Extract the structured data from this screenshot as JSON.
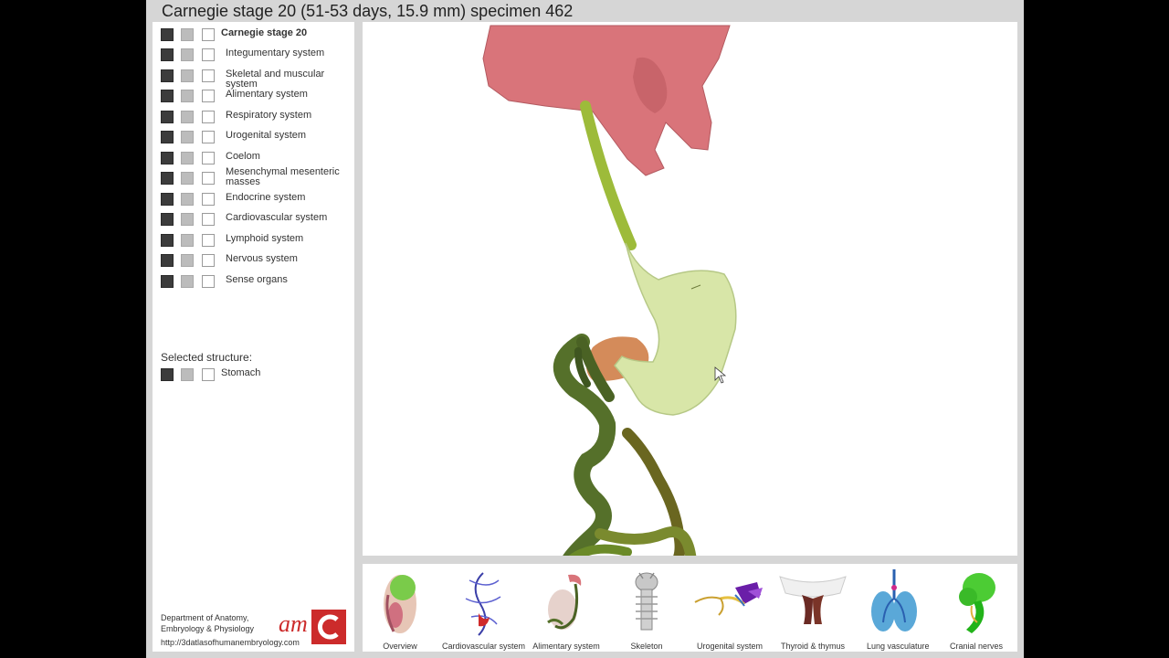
{
  "header": {
    "title": "Carnegie stage 20 (51-53 days, 15.9 mm) specimen 462"
  },
  "systems": [
    {
      "label": "Carnegie stage 20",
      "bold": true
    },
    {
      "label": "Integumentary system"
    },
    {
      "label": "Skeletal and muscular system"
    },
    {
      "label": "Alimentary system"
    },
    {
      "label": "Respiratory system"
    },
    {
      "label": "Urogenital system"
    },
    {
      "label": "Coelom"
    },
    {
      "label": "Mesenchymal mesenteric masses"
    },
    {
      "label": "Endocrine system"
    },
    {
      "label": "Cardiovascular system"
    },
    {
      "label": "Lymphoid system"
    },
    {
      "label": "Nervous system"
    },
    {
      "label": "Sense organs"
    }
  ],
  "selected": {
    "heading": "Selected structure:",
    "label": "Stomach"
  },
  "footer": {
    "dept_line1": "Department of Anatomy,",
    "dept_line2": "Embryology & Physiology",
    "url": "http://3datlasofhumanembryology.com",
    "logo_text": "am"
  },
  "thumbnails": [
    {
      "label": "Overview",
      "icon": "overview-thumbnail"
    },
    {
      "label": "Cardiovascular system",
      "icon": "cardiovascular-thumbnail"
    },
    {
      "label": "Alimentary system",
      "icon": "alimentary-thumbnail"
    },
    {
      "label": "Skeleton",
      "icon": "skeleton-thumbnail"
    },
    {
      "label": "Urogenital system",
      "icon": "urogenital-thumbnail"
    },
    {
      "label": "Thyroid & thymus",
      "icon": "thyroid-thumbnail"
    },
    {
      "label": "Lung vasculature",
      "icon": "lung-thumbnail"
    },
    {
      "label": "Cranial nerves",
      "icon": "cranial-nerves-thumbnail"
    }
  ],
  "colors": {
    "stomach": "#d8e6a8",
    "esophagus": "#9dbb3a",
    "intestine": "#55702a",
    "liver": "#d9747a",
    "logo_red": "#cc2b2b"
  }
}
